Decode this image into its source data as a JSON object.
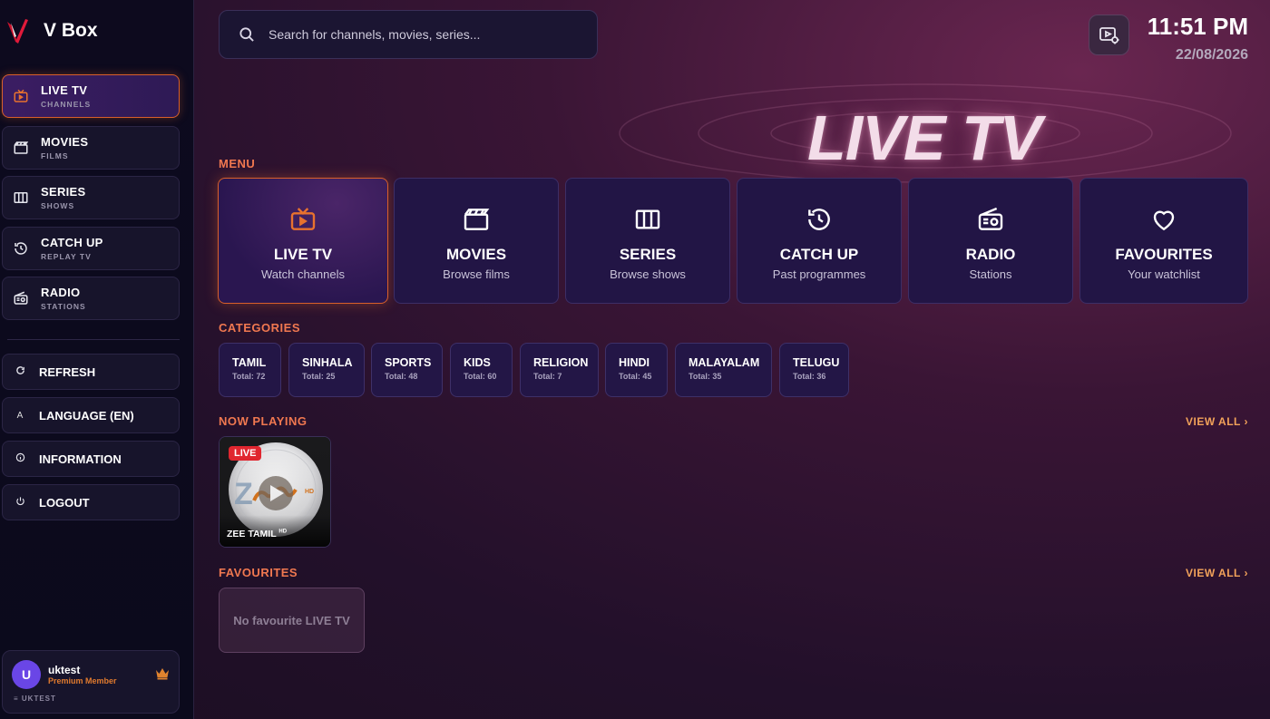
{
  "app": {
    "name": "V Box"
  },
  "sidebar": {
    "nav": [
      {
        "label": "LIVE TV",
        "sub": "CHANNELS",
        "icon": "tv-icon",
        "active": true
      },
      {
        "label": "MOVIES",
        "sub": "FILMS",
        "icon": "clapperboard-icon",
        "active": false
      },
      {
        "label": "SERIES",
        "sub": "SHOWS",
        "icon": "columns-icon",
        "active": false
      },
      {
        "label": "CATCH UP",
        "sub": "REPLAY TV",
        "icon": "history-icon",
        "active": false
      },
      {
        "label": "RADIO",
        "sub": "STATIONS",
        "icon": "radio-icon",
        "active": false
      }
    ],
    "utilities": [
      {
        "label": "REFRESH",
        "icon": "refresh-icon",
        "glyph": "C"
      },
      {
        "label": "LANGUAGE (EN)",
        "icon": "language-icon",
        "glyph": "A"
      },
      {
        "label": "INFORMATION",
        "icon": "info-icon",
        "glyph": "i"
      },
      {
        "label": "LOGOUT",
        "icon": "power-icon",
        "glyph": "⏻"
      }
    ],
    "user": {
      "initial": "U",
      "name": "uktest",
      "tier": "Premium Member",
      "id": "UKTEST"
    }
  },
  "header": {
    "search_placeholder": "Search for channels, movies, series...",
    "time": "11:51 PM",
    "date": "22/08/2026"
  },
  "hero": {
    "title": "LIVE TV"
  },
  "sections": {
    "menu": "MENU",
    "categories": "CATEGORIES",
    "now_playing": "NOW PLAYING",
    "favourites": "FAVOURITES",
    "view_all": "VIEW ALL ›"
  },
  "menu_cards": [
    {
      "title": "LIVE TV",
      "sub": "Watch channels",
      "icon": "tv-icon"
    },
    {
      "title": "MOVIES",
      "sub": "Browse films",
      "icon": "clapperboard-icon"
    },
    {
      "title": "SERIES",
      "sub": "Browse shows",
      "icon": "columns-icon"
    },
    {
      "title": "CATCH UP",
      "sub": "Past programmes",
      "icon": "history-icon"
    },
    {
      "title": "RADIO",
      "sub": "Stations",
      "icon": "radio-icon"
    },
    {
      "title": "FAVOURITES",
      "sub": "Your watchlist",
      "icon": "heart-icon"
    }
  ],
  "categories": [
    {
      "name": "TAMIL",
      "total": "Total: 72"
    },
    {
      "name": "SINHALA",
      "total": "Total: 25"
    },
    {
      "name": "SPORTS",
      "total": "Total: 48"
    },
    {
      "name": "KIDS",
      "total": "Total: 60"
    },
    {
      "name": "RELIGION",
      "total": "Total: 7"
    },
    {
      "name": "HINDI",
      "total": "Total: 45"
    },
    {
      "name": "MALAYALAM",
      "total": "Total: 35"
    },
    {
      "name": "TELUGU",
      "total": "Total: 36"
    }
  ],
  "now_playing": [
    {
      "badge": "LIVE",
      "name": "ZEE TAMIL",
      "name_suffix": "HD"
    }
  ],
  "favourites": {
    "empty_text": "No favourite LIVE TV"
  },
  "colors": {
    "accent": "#d8602a",
    "section": "#f07850",
    "live": "#e0262f",
    "avatar": "#6a46e6"
  }
}
